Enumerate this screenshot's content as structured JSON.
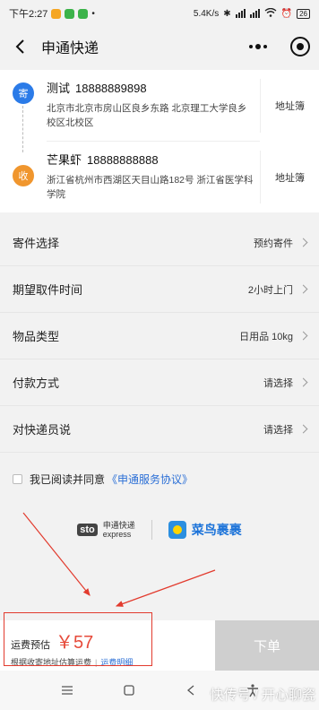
{
  "status_bar": {
    "time": "下午2:27",
    "network_speed": "5.4K/s",
    "battery": "26"
  },
  "nav": {
    "title": "申通快递"
  },
  "sender": {
    "badge": "寄",
    "name": "测试",
    "phone": "18888889898",
    "address": "北京市北京市房山区良乡东路 北京理工大学良乡校区北校区",
    "book_label": "地址簿"
  },
  "receiver": {
    "badge": "收",
    "name": "芒果虾",
    "phone": "18888888888",
    "address": "浙江省杭州市西湖区天目山路182号 浙江省医学科学院",
    "book_label": "地址簿"
  },
  "form": [
    {
      "label": "寄件选择",
      "value": "预约寄件"
    },
    {
      "label": "期望取件时间",
      "value": "2小时上门"
    },
    {
      "label": "物品类型",
      "value": "日用品 10kg"
    },
    {
      "label": "付款方式",
      "value": "请选择"
    },
    {
      "label": "对快递员说",
      "value": "请选择"
    }
  ],
  "agreement": {
    "text": "我已阅读并同意",
    "link": "《申通服务协议》"
  },
  "logos": {
    "sto_mark": "sto",
    "sto_name": "申通快递",
    "sto_en": "express",
    "cainiao_name": "菜鸟裹裹"
  },
  "footer": {
    "fee_label": "运费预估",
    "fee_amount": "￥57",
    "fee_note": "根据收寄地址估算运费",
    "fee_link": "运费明细",
    "order_button": "下单"
  },
  "watermark": "快传号 / 开心聊瓷",
  "colors": {
    "accent_blue": "#2b7be8",
    "accent_orange": "#f0962e",
    "fee_red": "#e64a3a",
    "annotation_red": "#e23b2e"
  }
}
